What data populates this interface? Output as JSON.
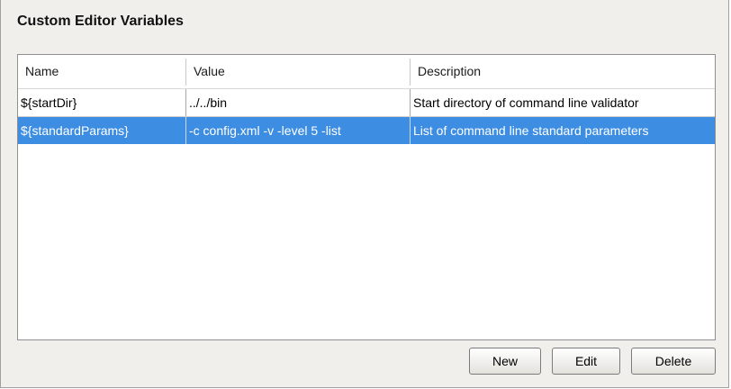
{
  "panel": {
    "title": "Custom Editor Variables"
  },
  "table": {
    "columns": [
      "Name",
      "Value",
      "Description"
    ],
    "rows": [
      {
        "name": "${startDir}",
        "value": "../../bin",
        "description": "Start directory of command line validator",
        "selected": false
      },
      {
        "name": "${standardParams}",
        "value": "-c config.xml -v -level 5 -list",
        "description": "List of command line standard parameters",
        "selected": true
      }
    ]
  },
  "buttons": {
    "new_label": "New",
    "edit_label": "Edit",
    "delete_label": "Delete"
  },
  "colors": {
    "selection": "#3d8de2",
    "panel_background": "#f0efeb"
  }
}
